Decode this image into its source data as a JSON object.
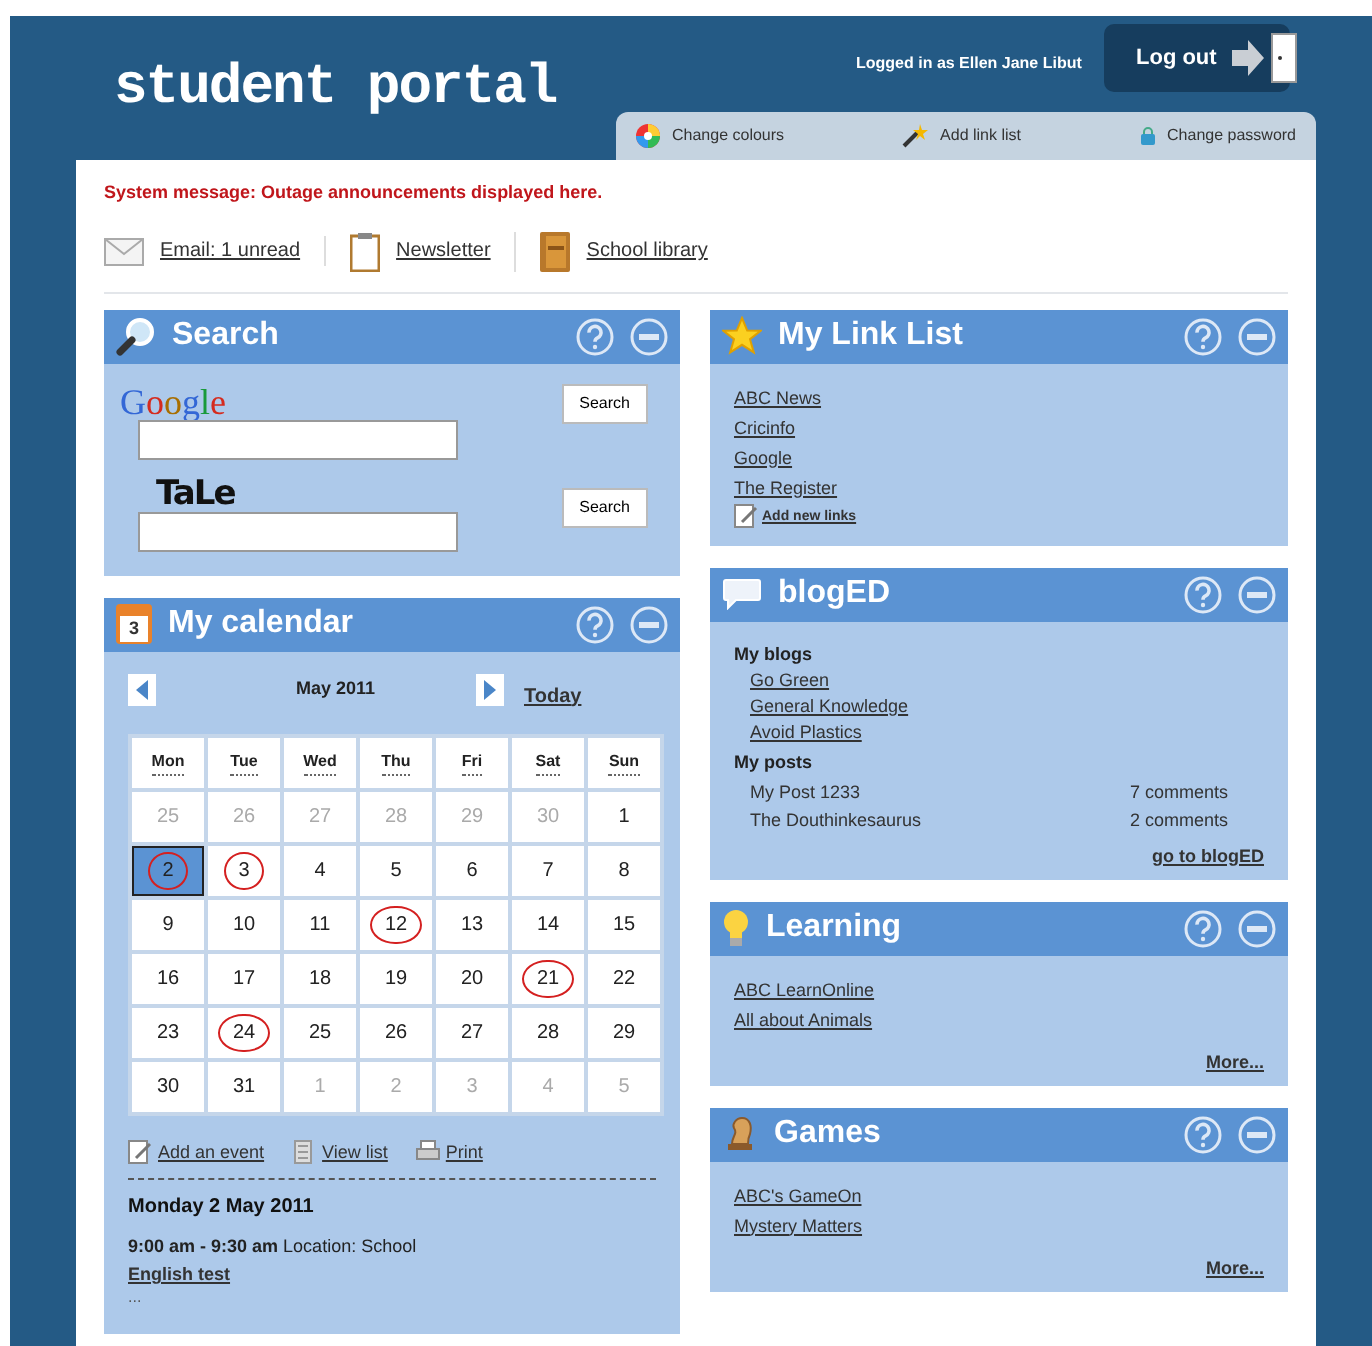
{
  "header": {
    "logo": "student portal",
    "logged_in": "Logged in as Ellen Jane Libut",
    "logout": "Log out"
  },
  "toolbar_tabs": [
    {
      "kind": "colours",
      "label": "Change colours"
    },
    {
      "kind": "wand",
      "label": "Add link list"
    },
    {
      "kind": "lock",
      "label": "Change password"
    }
  ],
  "system_message": "System message: Outage announcements displayed here.",
  "quick_links": [
    {
      "kind": "email",
      "label": "Email: 1 unread"
    },
    {
      "kind": "newsletter",
      "label": "Newsletter"
    },
    {
      "kind": "library",
      "label": "School library"
    }
  ],
  "left_widgets": [
    {
      "kind": "search",
      "title": "Search",
      "engines": [
        {
          "kind": "google",
          "logo": "Google",
          "button": "Search"
        },
        {
          "kind": "tale",
          "logo": "TaLe",
          "button": "Search"
        }
      ]
    },
    {
      "kind": "calendar",
      "title": "My calendar",
      "icon_label": "3",
      "month": "May 2011",
      "today": "Today",
      "weekdays": [
        "Mon",
        "Tue",
        "Wed",
        "Thu",
        "Fri",
        "Sat",
        "Sun"
      ],
      "days": [
        {
          "label": "25",
          "other_month": true,
          "marked": false,
          "selected": false
        },
        {
          "label": "26",
          "other_month": true,
          "marked": false,
          "selected": false
        },
        {
          "label": "27",
          "other_month": true,
          "marked": false,
          "selected": false
        },
        {
          "label": "28",
          "other_month": true,
          "marked": false,
          "selected": false
        },
        {
          "label": "29",
          "other_month": true,
          "marked": false,
          "selected": false
        },
        {
          "label": "30",
          "other_month": true,
          "marked": false,
          "selected": false
        },
        {
          "label": "1",
          "other_month": false,
          "marked": false,
          "selected": false
        },
        {
          "label": "2",
          "other_month": false,
          "marked": true,
          "selected": true
        },
        {
          "label": "3",
          "other_month": false,
          "marked": true,
          "selected": false
        },
        {
          "label": "4",
          "other_month": false,
          "marked": false,
          "selected": false
        },
        {
          "label": "5",
          "other_month": false,
          "marked": false,
          "selected": false
        },
        {
          "label": "6",
          "other_month": false,
          "marked": false,
          "selected": false
        },
        {
          "label": "7",
          "other_month": false,
          "marked": false,
          "selected": false
        },
        {
          "label": "8",
          "other_month": false,
          "marked": false,
          "selected": false
        },
        {
          "label": "9",
          "other_month": false,
          "marked": false,
          "selected": false
        },
        {
          "label": "10",
          "other_month": false,
          "marked": false,
          "selected": false
        },
        {
          "label": "11",
          "other_month": false,
          "marked": false,
          "selected": false
        },
        {
          "label": "12",
          "other_month": false,
          "marked": true,
          "selected": false
        },
        {
          "label": "13",
          "other_month": false,
          "marked": false,
          "selected": false
        },
        {
          "label": "14",
          "other_month": false,
          "marked": false,
          "selected": false
        },
        {
          "label": "15",
          "other_month": false,
          "marked": false,
          "selected": false
        },
        {
          "label": "16",
          "other_month": false,
          "marked": false,
          "selected": false
        },
        {
          "label": "17",
          "other_month": false,
          "marked": false,
          "selected": false
        },
        {
          "label": "18",
          "other_month": false,
          "marked": false,
          "selected": false
        },
        {
          "label": "19",
          "other_month": false,
          "marked": false,
          "selected": false
        },
        {
          "label": "20",
          "other_month": false,
          "marked": false,
          "selected": false
        },
        {
          "label": "21",
          "other_month": false,
          "marked": true,
          "selected": false
        },
        {
          "label": "22",
          "other_month": false,
          "marked": false,
          "selected": false
        },
        {
          "label": "23",
          "other_month": false,
          "marked": false,
          "selected": false
        },
        {
          "label": "24",
          "other_month": false,
          "marked": true,
          "selected": false
        },
        {
          "label": "25",
          "other_month": false,
          "marked": false,
          "selected": false
        },
        {
          "label": "26",
          "other_month": false,
          "marked": false,
          "selected": false
        },
        {
          "label": "27",
          "other_month": false,
          "marked": false,
          "selected": false
        },
        {
          "label": "28",
          "other_month": false,
          "marked": false,
          "selected": false
        },
        {
          "label": "29",
          "other_month": false,
          "marked": false,
          "selected": false
        },
        {
          "label": "30",
          "other_month": false,
          "marked": false,
          "selected": false
        },
        {
          "label": "31",
          "other_month": false,
          "marked": false,
          "selected": false
        },
        {
          "label": "1",
          "other_month": true,
          "marked": false,
          "selected": false
        },
        {
          "label": "2",
          "other_month": true,
          "marked": false,
          "selected": false
        },
        {
          "label": "3",
          "other_month": true,
          "marked": false,
          "selected": false
        },
        {
          "label": "4",
          "other_month": true,
          "marked": false,
          "selected": false
        },
        {
          "label": "5",
          "other_month": true,
          "marked": false,
          "selected": false
        }
      ],
      "actions": [
        {
          "kind": "add",
          "label": "Add an event"
        },
        {
          "kind": "list",
          "label": "View list"
        },
        {
          "kind": "print",
          "label": "Print"
        }
      ],
      "selected_date": "Monday 2 May 2011",
      "event": {
        "time": "9:00 am - 9:30 am",
        "location": "Location: School",
        "title": "English test",
        "more": "..."
      }
    }
  ],
  "right_widgets": [
    {
      "kind": "links",
      "title": "My Link List",
      "links": [
        "ABC News",
        "Cricinfo",
        "Google",
        "The Register"
      ],
      "add": "Add new links"
    },
    {
      "kind": "blog",
      "title": "blogED",
      "blogs_heading": "My blogs",
      "blogs": [
        "Go Green",
        "General Knowledge",
        "Avoid Plastics"
      ],
      "posts_heading": "My posts",
      "posts": [
        {
          "title": "My Post 1233",
          "comments": "7 comments"
        },
        {
          "title": "The Douthinkesaurus",
          "comments": "2 comments"
        }
      ],
      "footer": "go to blogED"
    },
    {
      "kind": "learning",
      "title": "Learning",
      "links": [
        "ABC LearnOnline",
        "All about Animals"
      ],
      "more": "More..."
    },
    {
      "kind": "games",
      "title": "Games",
      "links": [
        "ABC's GameOn",
        "Mystery Matters"
      ],
      "more": "More..."
    }
  ]
}
